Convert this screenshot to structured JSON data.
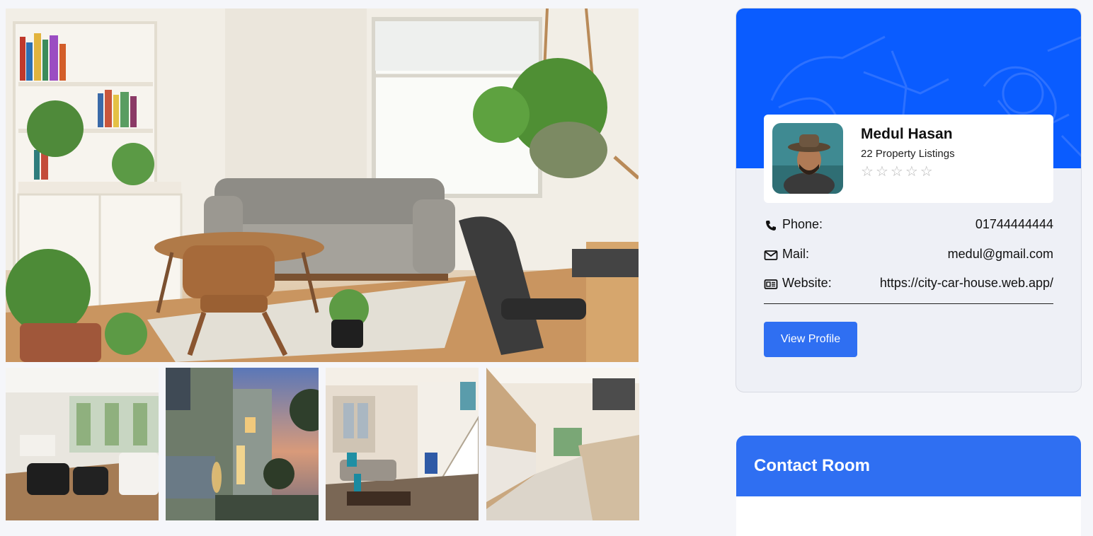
{
  "agent": {
    "name": "Medul Hasan",
    "listings": "22 Property Listings",
    "rating": {
      "value": 0,
      "max": 5
    },
    "phone_label": "Phone:",
    "phone": "01744444444",
    "mail_label": "Mail:",
    "mail": "medul@gmail.com",
    "website_label": "Website:",
    "website": "https://city-car-house.web.app/",
    "view_profile": "View Profile"
  },
  "contact": {
    "title": "Contact Room"
  },
  "gallery": {
    "main_photo_alt": "living room photo",
    "thumbs": [
      "living room thumbnail",
      "house exterior thumbnail",
      "interior with staircase thumbnail",
      "kitchen thumbnail"
    ]
  },
  "colors": {
    "banner": "#0a5cff",
    "button": "#2f6ff2",
    "contact_header": "#2f6ff2"
  },
  "icons": {
    "phone": "phone-icon",
    "mail": "mail-icon",
    "website": "website-icon",
    "star": "star-icon"
  }
}
